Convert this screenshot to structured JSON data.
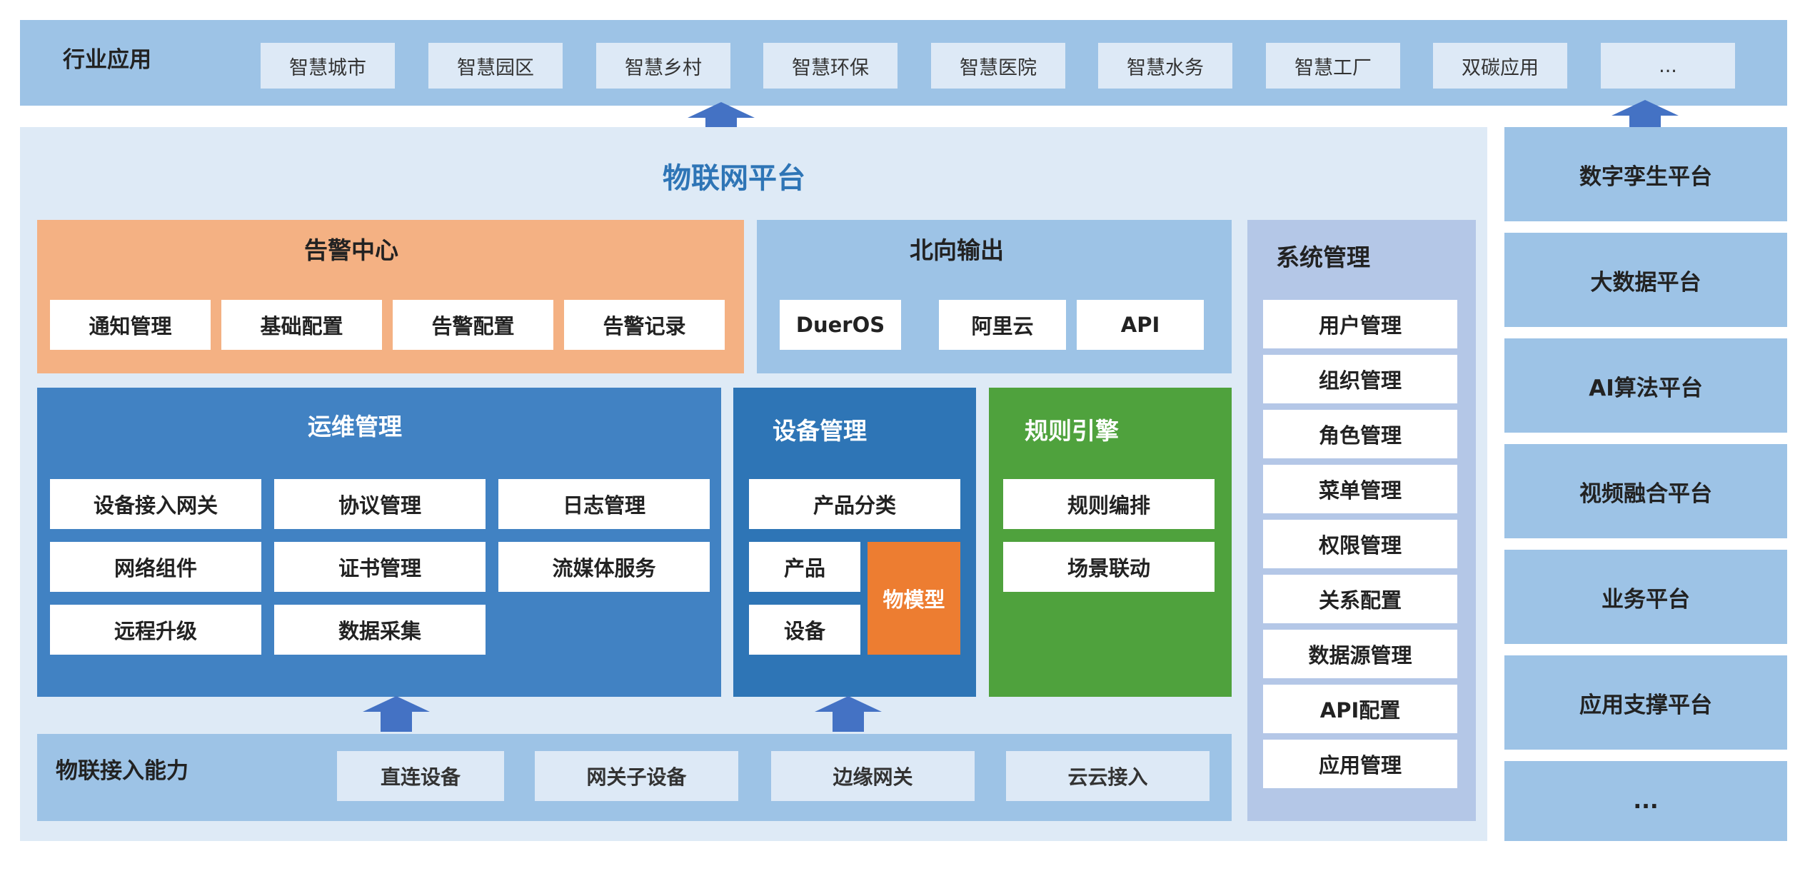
{
  "industry": {
    "label": "行业应用",
    "items": [
      "智慧城市",
      "智慧园区",
      "智慧乡村",
      "智慧环保",
      "智慧医院",
      "智慧水务",
      "智慧工厂",
      "双碳应用",
      "..."
    ]
  },
  "platform": {
    "title": "物联网平台",
    "alarm": {
      "title": "告警中心",
      "items": [
        "通知管理",
        "基础配置",
        "告警配置",
        "告警记录"
      ]
    },
    "north": {
      "title": "北向输出",
      "items": [
        "DuerOS",
        "阿里云",
        "API"
      ]
    },
    "system": {
      "title": "系统管理",
      "items": [
        "用户管理",
        "组织管理",
        "角色管理",
        "菜单管理",
        "权限管理",
        "关系配置",
        "数据源管理",
        "API配置",
        "应用管理"
      ]
    },
    "ops": {
      "title": "运维管理",
      "items": [
        "设备接入网关",
        "协议管理",
        "日志管理",
        "网络组件",
        "证书管理",
        "流媒体服务",
        "远程升级",
        "数据采集"
      ]
    },
    "device": {
      "title": "设备管理",
      "category": "产品分类",
      "product": "产品",
      "device": "设备",
      "model": "物模型"
    },
    "rules": {
      "title": "规则引擎",
      "items": [
        "规则编排",
        "场景联动"
      ]
    },
    "access": {
      "title": "物联接入能力",
      "items": [
        "直连设备",
        "网关子设备",
        "边缘网关",
        "云云接入"
      ]
    }
  },
  "side_platforms": [
    "数字孪生平台",
    "大数据平台",
    "AI算法平台",
    "视频融合平台",
    "业务平台",
    "应用支撑平台",
    "..."
  ],
  "colors": {
    "light_blue": "#9dc3e6",
    "pale_blue": "#deeaf6",
    "orange_panel": "#f4b183",
    "ops_blue": "#4182c3",
    "device_blue": "#2e75b6",
    "rules_green": "#4fa23d",
    "model_orange": "#ed7d31",
    "system_panel": "#b4c7e7",
    "arrow_blue": "#4472c4",
    "title_blue": "#2e75b6"
  }
}
